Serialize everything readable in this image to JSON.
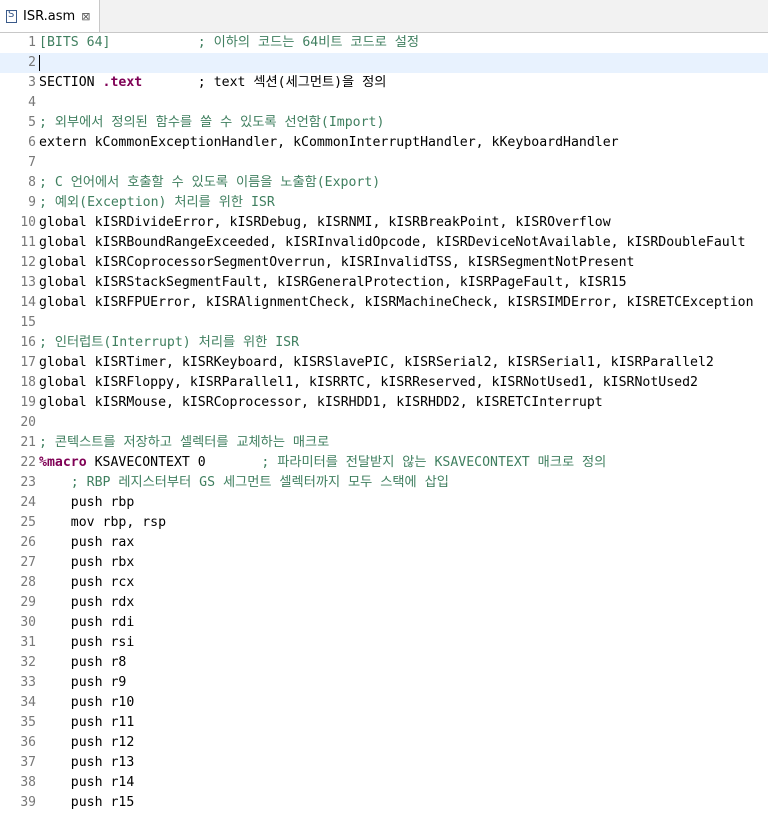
{
  "tab": {
    "title": "ISR.asm",
    "close_glyph": "⊠",
    "icon": "asm-file-icon"
  },
  "colors": {
    "comment": "#3f7f5f",
    "keyword": "#7f0055",
    "line_number": "#787878",
    "current_line": "#e8f2fe"
  },
  "lines": [
    {
      "n": "1",
      "segs": [
        {
          "t": "[BITS 64]           ; 이하의 코드는 64비트 코드로 설정",
          "c": "cm"
        }
      ]
    },
    {
      "n": "2",
      "segs": [],
      "current": true
    },
    {
      "n": "3",
      "segs": [
        {
          "t": "SECTION "
        },
        {
          "t": ".text",
          "c": "kw"
        },
        {
          "t": "       ; text 섹션(세그먼트)을 정의"
        }
      ]
    },
    {
      "n": "4",
      "segs": []
    },
    {
      "n": "5",
      "segs": [
        {
          "t": "; 외부에서 정의된 함수를 쓸 수 있도록 선언함(Import)",
          "c": "cm"
        }
      ]
    },
    {
      "n": "6",
      "segs": [
        {
          "t": "extern kCommonExceptionHandler, kCommonInterruptHandler, kKeyboardHandler"
        }
      ]
    },
    {
      "n": "7",
      "segs": []
    },
    {
      "n": "8",
      "segs": [
        {
          "t": "; C 언어에서 호출할 수 있도록 이름을 노출함(Export)",
          "c": "cm"
        }
      ]
    },
    {
      "n": "9",
      "segs": [
        {
          "t": "; 예외(Exception) 처리를 위한 ISR",
          "c": "cm"
        }
      ]
    },
    {
      "n": "10",
      "segs": [
        {
          "t": "global kISRDivideError, kISRDebug, kISRNMI, kISRBreakPoint, kISROverflow"
        }
      ]
    },
    {
      "n": "11",
      "segs": [
        {
          "t": "global kISRBoundRangeExceeded, kISRInvalidOpcode, kISRDeviceNotAvailable, kISRDoubleFault"
        }
      ]
    },
    {
      "n": "12",
      "segs": [
        {
          "t": "global kISRCoprocessorSegmentOverrun, kISRInvalidTSS, kISRSegmentNotPresent"
        }
      ]
    },
    {
      "n": "13",
      "segs": [
        {
          "t": "global kISRStackSegmentFault, kISRGeneralProtection, kISRPageFault, kISR15"
        }
      ]
    },
    {
      "n": "14",
      "segs": [
        {
          "t": "global kISRFPUError, kISRAlignmentCheck, kISRMachineCheck, kISRSIMDError, kISRETCException"
        }
      ]
    },
    {
      "n": "15",
      "segs": []
    },
    {
      "n": "16",
      "segs": [
        {
          "t": "; 인터럽트(Interrupt) 처리를 위한 ISR",
          "c": "cm"
        }
      ]
    },
    {
      "n": "17",
      "segs": [
        {
          "t": "global kISRTimer, kISRKeyboard, kISRSlavePIC, kISRSerial2, kISRSerial1, kISRParallel2"
        }
      ]
    },
    {
      "n": "18",
      "segs": [
        {
          "t": "global kISRFloppy, kISRParallel1, kISRRTC, kISRReserved, kISRNotUsed1, kISRNotUsed2"
        }
      ]
    },
    {
      "n": "19",
      "segs": [
        {
          "t": "global kISRMouse, kISRCoprocessor, kISRHDD1, kISRHDD2, kISRETCInterrupt"
        }
      ]
    },
    {
      "n": "20",
      "segs": []
    },
    {
      "n": "21",
      "segs": [
        {
          "t": "; 콘텍스트를 저장하고 셀렉터를 교체하는 매크로",
          "c": "cm"
        }
      ]
    },
    {
      "n": "22",
      "segs": [
        {
          "t": "%macro",
          "c": "kw"
        },
        {
          "t": " KSAVECONTEXT 0       "
        },
        {
          "t": "; 파라미터를 전달받지 않는 KSAVECONTEXT 매크로 정의",
          "c": "cm"
        }
      ]
    },
    {
      "n": "23",
      "segs": [
        {
          "t": "    "
        },
        {
          "t": "; RBP 레지스터부터 GS 세그먼트 셀렉터까지 모두 스택에 삽입",
          "c": "cm"
        }
      ]
    },
    {
      "n": "24",
      "segs": [
        {
          "t": "    push rbp"
        }
      ]
    },
    {
      "n": "25",
      "segs": [
        {
          "t": "    mov rbp, rsp"
        }
      ]
    },
    {
      "n": "26",
      "segs": [
        {
          "t": "    push rax"
        }
      ]
    },
    {
      "n": "27",
      "segs": [
        {
          "t": "    push rbx"
        }
      ]
    },
    {
      "n": "28",
      "segs": [
        {
          "t": "    push rcx"
        }
      ]
    },
    {
      "n": "29",
      "segs": [
        {
          "t": "    push rdx"
        }
      ]
    },
    {
      "n": "30",
      "segs": [
        {
          "t": "    push rdi"
        }
      ]
    },
    {
      "n": "31",
      "segs": [
        {
          "t": "    push rsi"
        }
      ]
    },
    {
      "n": "32",
      "segs": [
        {
          "t": "    push r8"
        }
      ]
    },
    {
      "n": "33",
      "segs": [
        {
          "t": "    push r9"
        }
      ]
    },
    {
      "n": "34",
      "segs": [
        {
          "t": "    push r10"
        }
      ]
    },
    {
      "n": "35",
      "segs": [
        {
          "t": "    push r11"
        }
      ]
    },
    {
      "n": "36",
      "segs": [
        {
          "t": "    push r12"
        }
      ]
    },
    {
      "n": "37",
      "segs": [
        {
          "t": "    push r13"
        }
      ]
    },
    {
      "n": "38",
      "segs": [
        {
          "t": "    push r14"
        }
      ]
    },
    {
      "n": "39",
      "segs": [
        {
          "t": "    push r15"
        }
      ]
    }
  ]
}
